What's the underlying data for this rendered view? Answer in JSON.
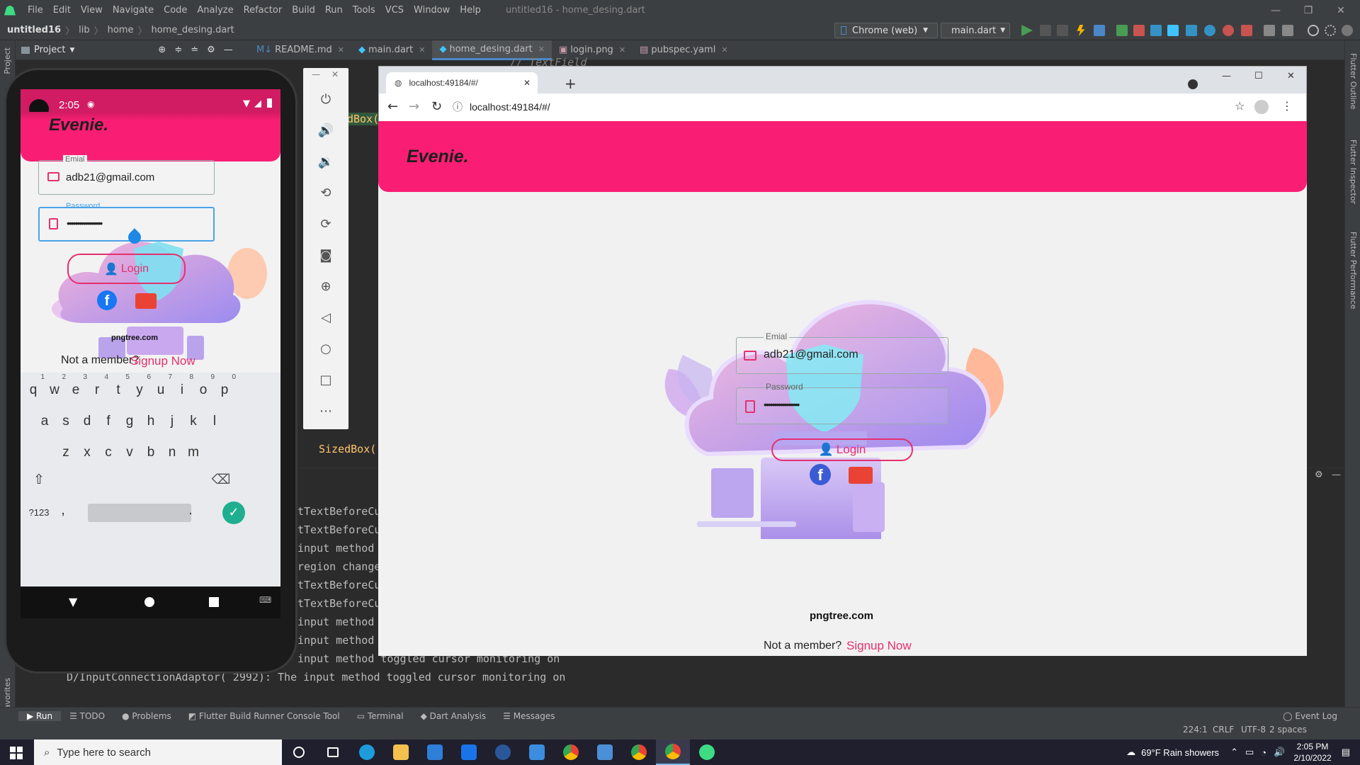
{
  "ide": {
    "menu": [
      "File",
      "Edit",
      "View",
      "Navigate",
      "Code",
      "Analyze",
      "Refactor",
      "Build",
      "Run",
      "Tools",
      "VCS",
      "Window",
      "Help"
    ],
    "window_title": "untitled16 - home_desing.dart",
    "breadcrumb": [
      "untitled16",
      "lib",
      "home",
      "home_desing.dart"
    ],
    "device_selector": "Chrome (web)",
    "run_config": "main.dart",
    "project_label": "Project",
    "tabs": [
      "README.md",
      "main.dart",
      "home_desing.dart",
      "login.png",
      "pubspec.yaml"
    ],
    "active_tab": "home_desing.dart",
    "code_snippets": [
      "// TextField",
      "dBox(",
      "SizedBox("
    ],
    "side_left": [
      "Project",
      "Favorites"
    ],
    "side_right": [
      "Flutter Outline",
      "Flutter Inspector",
      "Flutter Performance"
    ],
    "console_lines": [
      "tTextBeforeCu",
      "tTextBeforeCu",
      " input method",
      "region change",
      "tTextBeforeCu",
      "tTextBeforeCu",
      " input method",
      " input method",
      " input method toggled cursor monitoring on",
      "D/InputConnectionAdaptor( 2992): The input method toggled cursor monitoring on"
    ],
    "bottom_tools": [
      "Run",
      "TODO",
      "Problems",
      "Flutter Build Runner Console Tool",
      "Terminal",
      "Dart Analysis",
      "Messages"
    ],
    "event_log": "Event Log",
    "status": {
      "position": "224:1",
      "line_sep": "CRLF",
      "encoding": "UTF-8",
      "indent": "2 spaces"
    }
  },
  "phone": {
    "time": "2:05",
    "brand": "Evenie.",
    "email_label": "Emial",
    "email_value": "adb21@gmail.com",
    "password_label": "Password",
    "password_value": "•••••••••••••••••",
    "login_label": "Login",
    "watermark": "pngtree.com",
    "not_member": "Not a member?",
    "signup": "Signup Now",
    "keyboard_row1": [
      "q",
      "w",
      "e",
      "r",
      "t",
      "y",
      "u",
      "i",
      "o",
      "p"
    ],
    "keyboard_row1_nums": [
      "1",
      "2",
      "3",
      "4",
      "5",
      "6",
      "7",
      "8",
      "9",
      "0"
    ],
    "keyboard_row2": [
      "a",
      "s",
      "d",
      "f",
      "g",
      "h",
      "j",
      "k",
      "l"
    ],
    "keyboard_row3": [
      "z",
      "x",
      "c",
      "v",
      "b",
      "n",
      "m"
    ],
    "sym_key": "?123",
    "comma": ",",
    "period": "."
  },
  "browser": {
    "tab_title": "localhost:49184/#/",
    "url": "localhost:49184/#/",
    "brand": "Evenie.",
    "email_label": "Emial",
    "email_value": "adb21@gmail.com",
    "password_label": "Password",
    "password_value": "•••••••••••••••••",
    "login_label": "Login",
    "watermark": "pngtree.com",
    "not_member": "Not a member?",
    "signup": "Signup Now"
  },
  "taskbar": {
    "search_placeholder": "Type here to search",
    "weather": "69°F  Rain showers",
    "time": "2:05 PM",
    "date": "2/10/2022"
  },
  "colors": {
    "pink": "#f91e73",
    "accent": "#e5306f",
    "ide_bg": "#2b2b2b"
  }
}
